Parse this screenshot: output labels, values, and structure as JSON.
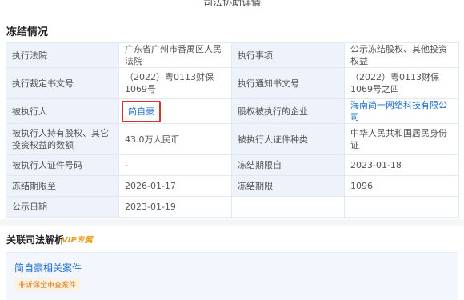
{
  "window": {
    "title": "司法协助详情"
  },
  "freeze": {
    "section_title": "冻结情况",
    "rows": [
      {
        "l1": "执行法院",
        "v1": "广东省广州市番禺区人民法院",
        "l2": "执行事项",
        "v2": "公示冻结股权、其他投资权益"
      },
      {
        "l1": "执行裁定书文号",
        "v1": "（2022）粤0113财保1069号",
        "l2": "执行通知书文号",
        "v2": "（2022）粤0113财保1069号之四"
      },
      {
        "l1": "被执行人",
        "v1": "简自豪",
        "l2": "股权被执行的企业",
        "v2": "海南简一网络科技有限公司"
      },
      {
        "l1": "被执行人持有股权、其它投资权益的数额",
        "v1": "43.0万人民币",
        "l2": "被执行人证件种类",
        "v2": "中华人民共和国居民身份证"
      },
      {
        "l1": "被执行人证件号码",
        "v1": "-",
        "l2": "冻结期限自",
        "v2": "2023-01-18"
      },
      {
        "l1": "冻结期限至",
        "v1": "2026-01-17",
        "l2": "冻结期限",
        "v2": "1096"
      },
      {
        "l1": "公示日期",
        "v1": "2023-01-19"
      }
    ]
  },
  "related": {
    "title": "关联司法解析",
    "vip_badge": "VIP专属",
    "card_title": "简自豪相关案件",
    "card_tag": "非诉保全审查案件"
  }
}
